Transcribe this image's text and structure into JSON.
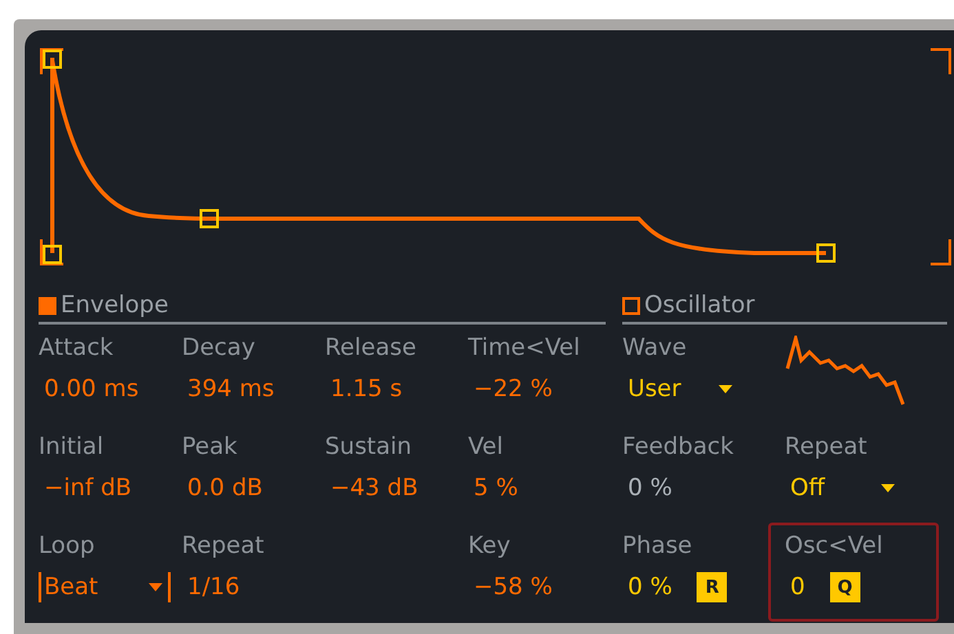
{
  "envelope": {
    "title": "Envelope",
    "enabled": true,
    "params": [
      {
        "kind": "value",
        "label": "Attack",
        "value": "0.00 ms",
        "color": "#ff6a00"
      },
      {
        "kind": "value",
        "label": "Decay",
        "value": "394 ms",
        "color": "#ff6a00"
      },
      {
        "kind": "value",
        "label": "Release",
        "value": "1.15 s",
        "color": "#ff6a00"
      },
      {
        "kind": "value",
        "label": "Time<Vel",
        "value": "−22 %",
        "color": "#ff6a00"
      },
      {
        "kind": "value",
        "label": "Initial",
        "value": "−inf dB",
        "color": "#ff6a00"
      },
      {
        "kind": "value",
        "label": "Peak",
        "value": "0.0 dB",
        "color": "#ff6a00"
      },
      {
        "kind": "value",
        "label": "Sustain",
        "value": "−43 dB",
        "color": "#ff6a00"
      },
      {
        "kind": "value",
        "label": "Vel",
        "value": "5 %",
        "color": "#ff6a00"
      },
      {
        "kind": "loop",
        "label": "Loop",
        "value": "Beat",
        "color": "#ff6a00"
      },
      {
        "kind": "value",
        "label": "Repeat",
        "value": "1/16",
        "color": "#ff6a00"
      },
      {
        "kind": "value",
        "label": "Key",
        "value": "−58 %",
        "color": "#ff6a00"
      }
    ]
  },
  "oscillator": {
    "title": "Oscillator",
    "enabled": false,
    "params": [
      {
        "kind": "dropdown",
        "label": "Wave",
        "value": "User",
        "color": "#ffc800"
      },
      {
        "kind": "wave"
      },
      {
        "kind": "value",
        "label": "Feedback",
        "value": "0 %",
        "color": "#aab0b6"
      },
      {
        "kind": "dropdown",
        "label": "Repeat",
        "value": "Off",
        "color": "#ffc800"
      },
      {
        "kind": "button",
        "label": "Phase",
        "value": "0 %",
        "color": "#ffc800",
        "button": "R"
      },
      {
        "kind": "button",
        "label": "Osc<Vel",
        "value": "0",
        "color": "#ffc800",
        "button": "Q",
        "highlighted": true
      }
    ]
  }
}
